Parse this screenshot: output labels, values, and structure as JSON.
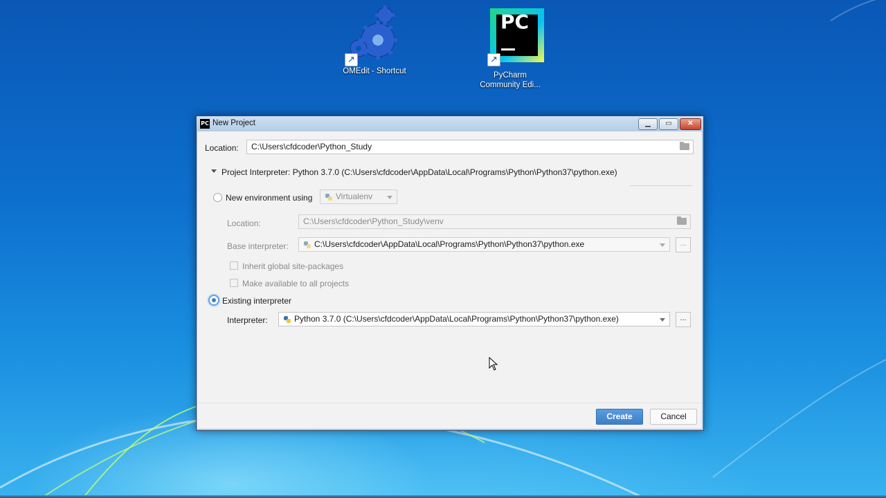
{
  "desktop": {
    "icons": [
      {
        "label": "OMEdit - Shortcut",
        "icon": "gears-icon"
      },
      {
        "label_line1": "PyCharm",
        "label_line2": "Community Edi...",
        "icon": "pycharm-icon",
        "logo_text": "PC"
      }
    ]
  },
  "window": {
    "title": "New Project",
    "app_icon_text": "PC",
    "controls": {
      "minimize": "minimize",
      "maximize": "maximize",
      "close": "close"
    }
  },
  "form": {
    "location_label": "Location:",
    "location_value": "C:\\Users\\cfdcoder\\Python_Study",
    "interpreter_section_title": "Project Interpreter: Python 3.7.0 (C:\\Users\\cfdcoder\\AppData\\Local\\Programs\\Python\\Python37\\python.exe)",
    "new_env": {
      "radio_label": "New environment using",
      "tool_value": "Virtualenv",
      "location_label": "Location:",
      "location_value": "C:\\Users\\cfdcoder\\Python_Study\\venv",
      "base_interpreter_label": "Base interpreter:",
      "base_interpreter_value": "C:\\Users\\cfdcoder\\AppData\\Local\\Programs\\Python\\Python37\\python.exe",
      "browse_label": "...",
      "inherit_label": "Inherit global site-packages",
      "make_available_label": "Make available to all projects",
      "selected": false
    },
    "existing": {
      "radio_label": "Existing interpreter",
      "interpreter_label": "Interpreter:",
      "interpreter_value": "Python 3.7.0 (C:\\Users\\cfdcoder\\AppData\\Local\\Programs\\Python\\Python37\\python.exe)",
      "browse_label": "...",
      "selected": true
    }
  },
  "buttons": {
    "create": "Create",
    "cancel": "Cancel"
  },
  "colors": {
    "accent": "#3d7fc8",
    "desktop_blue": "#0d6fcd"
  }
}
